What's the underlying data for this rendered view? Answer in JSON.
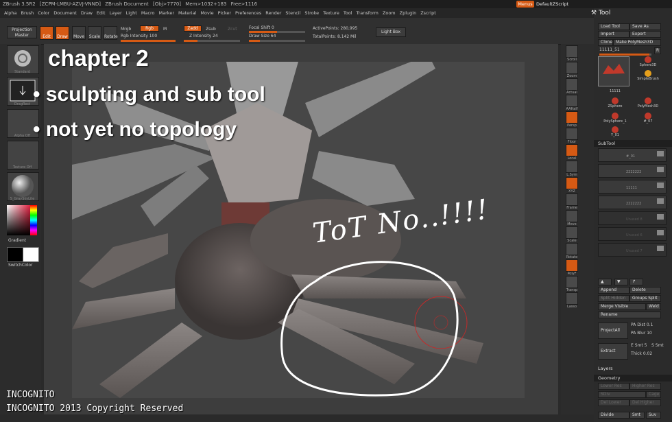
{
  "titlebar": {
    "app": "ZBrush 3.5R2",
    "license": "[ZCPM-LMBU-AZVJ-VNND]",
    "document": "ZBrush Document",
    "obj": "[Obj>7770]",
    "mem": "Mem>1032+183",
    "free": "Free>1116",
    "menus_button": "Menus",
    "script": "DefaultZScript"
  },
  "menubar": [
    "Alpha",
    "Brush",
    "Color",
    "Document",
    "Draw",
    "Edit",
    "Layer",
    "Light",
    "Macro",
    "Marker",
    "Material",
    "Movie",
    "Picker",
    "Preferences",
    "Render",
    "Stencil",
    "Stroke",
    "Texture",
    "Tool",
    "Transform",
    "Zoom",
    "Zplugin",
    "Zscript"
  ],
  "topbar": {
    "projection_master": "Projection Master",
    "edit": "Edit",
    "draw": "Draw",
    "move": "Move",
    "scale": "Scale",
    "rotate": "Rotate",
    "mrgb": "Mrgb",
    "rgb": "Rgb",
    "m": "M",
    "rgb_intensity": "Rgb Intensity 100",
    "zadd": "Zadd",
    "zsub": "Zsub",
    "zcut": "Zcut",
    "z_intensity": "Z Intensity 24",
    "focal_shift": "Focal Shift 0",
    "draw_size": "Draw Size 64",
    "active_points": "ActivePoints: 280,995",
    "total_points": "TotalPoints: 8.142 Mil",
    "light_box": "Light Box"
  },
  "left_shelf": {
    "standard": "Standard",
    "dragrect": "DragRect",
    "alpha_off": "Alpha Off",
    "texture_off": "Texture Off",
    "material": "S_GraySkyLite",
    "gradient": "Gradient",
    "switch_color": "SwitchColor"
  },
  "right_shelf": [
    "Scroll",
    "Zoom",
    "Actual",
    "AAHalf",
    "Persp",
    "Floor",
    "Local",
    "L.Sym",
    "XYZ",
    "Frame",
    "Move",
    "Scale",
    "Rotate",
    "PolyF",
    "Transp",
    "Lasso"
  ],
  "overlay": {
    "heading": "chapter 2",
    "bullets": [
      "sculpting and sub tool",
      "not yet no topology"
    ],
    "handwriting": "ToT No..!!!!",
    "footer_line1": "INCOGNITO",
    "footer_line2": "INCOGNITO 2013 Copyright Reserved"
  },
  "tool_panel": {
    "title": "Tool",
    "load_tool": "Load Tool",
    "save_as": "Save As",
    "import": "Import",
    "export": "Export",
    "clone": "Clone",
    "make_polymesh": "Make PolyMesh3D",
    "current_tool": "11111_51",
    "r": "R",
    "tools": [
      {
        "name": "11111"
      },
      {
        "name": "Sphere3D"
      },
      {
        "name": "SimpleBrush"
      },
      {
        "name": "ZSphere"
      },
      {
        "name": "PolyMesh3D"
      },
      {
        "name": "PolySphere_1"
      },
      {
        "name": "#_07"
      },
      {
        "name": "Y_01"
      }
    ],
    "subtool_header": "SubTool",
    "subtools": [
      "#_01",
      "2222222",
      "11111",
      "2222222",
      "Unused 8",
      "Unused 6",
      "Unused 7"
    ],
    "append": "Append",
    "delete": "Delete",
    "split_hidden": "Split Hidden",
    "groups_split": "Groups Split",
    "merge_visible": "Merge Visible",
    "weld": "Weld",
    "rename": "Rename",
    "project_all": "ProjectAll",
    "pa_dist": "PA Dist 0.1",
    "pa_blur": "PA Blur 10",
    "extract": "Extract",
    "e_smt": "E Smt 5",
    "s_smt": "S Smt",
    "thick": "Thick 0.02",
    "layers": "Layers",
    "geometry": "Geometry",
    "lower_res": "Lower Res",
    "higher_res": "Higher Res",
    "sdiv": "SDiv",
    "cage": "Cage",
    "del_lower": "Del Lower",
    "del_higher": "Del Higher",
    "divide": "Divide",
    "smt": "Smt",
    "suv": "Suv"
  }
}
